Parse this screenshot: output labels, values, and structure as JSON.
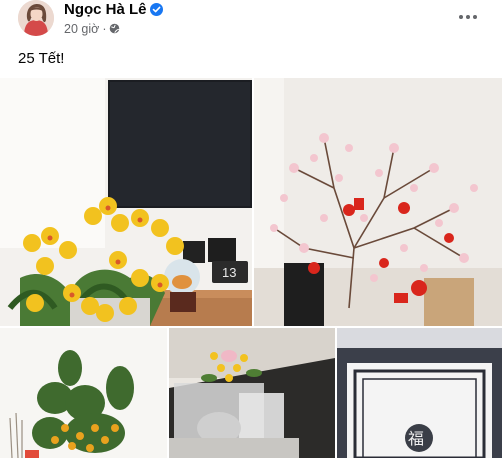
{
  "post": {
    "author": "Ngọc Hà Lê",
    "verified_icon": "verified-badge-icon",
    "timestamp": "20 giờ",
    "separator": "·",
    "audience_icon": "globe-icon",
    "more_icon": "more-options-icon",
    "caption": "25 Tết!",
    "accent_color": "#1877f2"
  },
  "photos": {
    "p1": {
      "clock_text": "13"
    },
    "p5": {
      "calligraphy": "福"
    }
  }
}
